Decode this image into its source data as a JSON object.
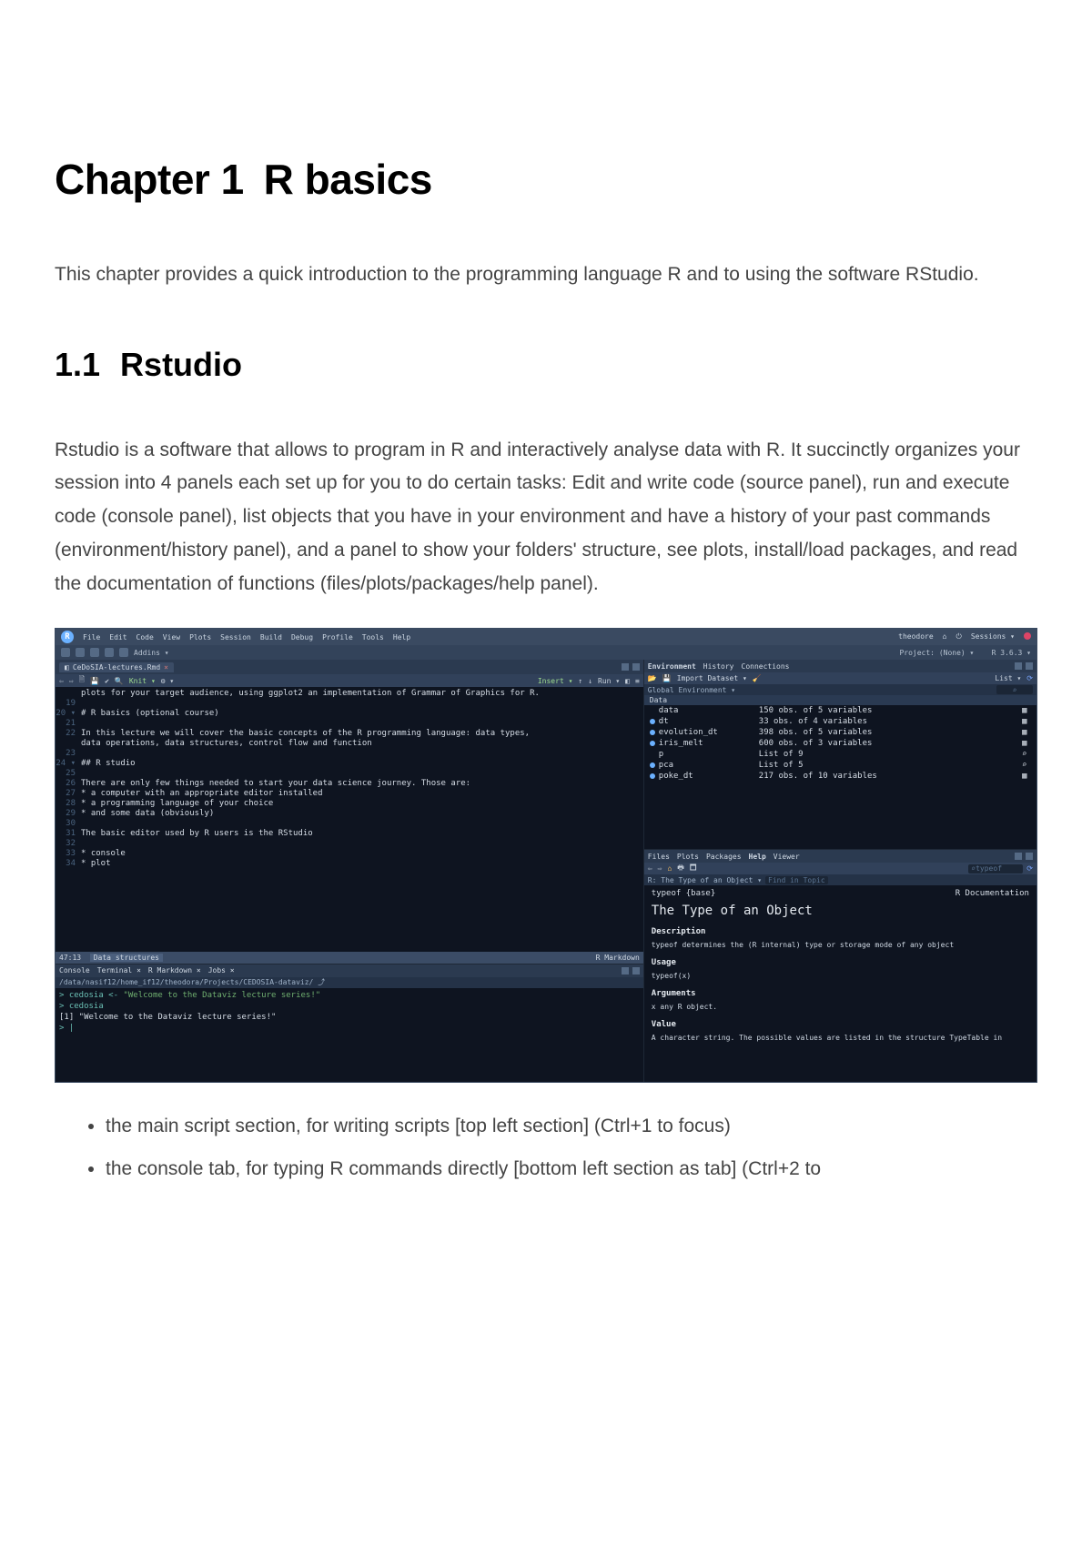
{
  "doc": {
    "chapter_number": "Chapter 1",
    "chapter_title": "R basics",
    "intro": "This chapter provides a quick introduction to the programming language R and to using the software RStudio.",
    "section_number": "1.1",
    "section_title": "Rstudio",
    "body1": "Rstudio is a software that allows to program in R and interactively analyse data with R. It succinctly organizes your session into 4 panels each set up for you to do certain tasks: Edit and write code (source panel), run and execute code (console panel), list objects that you have in your environment and have a history of your past commands (environment/history panel), and a panel to show your folders' structure, see plots, install/load packages, and read the documentation of functions (files/plots/packages/help panel).",
    "bullets": [
      "the main script section, for writing scripts [top left section] (Ctrl+1 to focus)",
      "the console tab, for typing R commands directly [bottom left section as tab] (Ctrl+2 to"
    ]
  },
  "rstudio": {
    "menubar": {
      "items": [
        "File",
        "Edit",
        "Code",
        "View",
        "Plots",
        "Session",
        "Build",
        "Debug",
        "Profile",
        "Tools",
        "Help"
      ],
      "user": "theodore",
      "sessions": "Sessions ▾"
    },
    "toolbar": {
      "addins": "Addins ▾",
      "project": "Project: (None) ▾",
      "rver": "R 3.6.3 ▾"
    },
    "source": {
      "tab": "CeDoSIA-lectures.Rmd",
      "knit": "Knit ▾",
      "gear": "⚙ ▾",
      "insert": "Insert ▾",
      "run": "Run ▾",
      "status_left": "47:13",
      "status_mid": "Data structures",
      "status_right": "R Markdown",
      "lines": [
        {
          "n": "",
          "c": "plots for your target audience, using ggplot2 an implementation of Grammar of Graphics for R."
        },
        {
          "n": "19",
          "c": ""
        },
        {
          "n": "20 ▾",
          "c": "# R basics (optional course)",
          "teal": true
        },
        {
          "n": "21",
          "c": ""
        },
        {
          "n": "22",
          "c": "In this lecture we will cover the basic concepts of the R programming language: data types,"
        },
        {
          "n": "",
          "c": "data operations, data structures, control flow and function"
        },
        {
          "n": "23",
          "c": ""
        },
        {
          "n": "24 ▾",
          "c": "## R studio",
          "teal": true
        },
        {
          "n": "25",
          "c": ""
        },
        {
          "n": "26",
          "c": "There are only few things needed to start your data science journey. Those are:"
        },
        {
          "n": "27",
          "c": "* a computer with an appropriate editor installed"
        },
        {
          "n": "28",
          "c": "* a programming language of your choice"
        },
        {
          "n": "29",
          "c": "* and some data (obviously)"
        },
        {
          "n": "30",
          "c": ""
        },
        {
          "n": "31",
          "c": "The basic editor used by R users is the RStudio"
        },
        {
          "n": "32",
          "c": ""
        },
        {
          "n": "33",
          "c": "* console"
        },
        {
          "n": "34",
          "c": "* plot"
        }
      ]
    },
    "console": {
      "tabs": [
        "Console",
        "Terminal ×",
        "R Markdown ×",
        "Jobs ×"
      ],
      "path": "/data/nasif12/home_if12/theodora/Projects/CEDOSIA-dataviz/",
      "l1_prefix": "> cedosia <- ",
      "l1_str": "\"Welcome to the Dataviz lecture series!\"",
      "l2": "> cedosia",
      "l3": "[1] \"Welcome to the Dataviz lecture series!\"",
      "l4": "> |"
    },
    "env": {
      "tabs": [
        "Environment",
        "History",
        "Connections"
      ],
      "import": "Import Dataset ▾",
      "list": "List ▾",
      "global": "Global Environment ▾",
      "section": "Data",
      "rows": [
        {
          "dot": false,
          "name": "data",
          "desc": "150 obs. of 5 variables",
          "icon": "▦"
        },
        {
          "dot": true,
          "name": "dt",
          "desc": "33 obs. of 4 variables",
          "icon": "▦"
        },
        {
          "dot": true,
          "name": "evolution_dt",
          "desc": "398 obs. of 5 variables",
          "icon": "▦"
        },
        {
          "dot": true,
          "name": "iris_melt",
          "desc": "600 obs. of 3 variables",
          "icon": "▦"
        },
        {
          "dot": false,
          "name": "p",
          "desc": "List of 9",
          "icon": "⌕"
        },
        {
          "dot": true,
          "name": "pca",
          "desc": "List of 5",
          "icon": "⌕"
        },
        {
          "dot": true,
          "name": "poke_dt",
          "desc": "217 obs. of 10 variables",
          "icon": "▦"
        }
      ]
    },
    "help": {
      "tabs": [
        "Files",
        "Plots",
        "Packages",
        "Help",
        "Viewer"
      ],
      "search_placeholder": "typeof",
      "crumb": "R: The Type of an Object ▾",
      "find": "Find in Topic",
      "topleft": "typeof {base}",
      "topright": "R Documentation",
      "title": "The Type of an Object",
      "desc_h": "Description",
      "desc_p": "typeof determines the (R internal) type or storage mode of any object",
      "usage_h": "Usage",
      "usage_p": "typeof(x)",
      "args_h": "Arguments",
      "args_p": "x    any R object.",
      "value_h": "Value",
      "value_p": "A character string. The possible values are listed in the structure TypeTable in"
    }
  }
}
